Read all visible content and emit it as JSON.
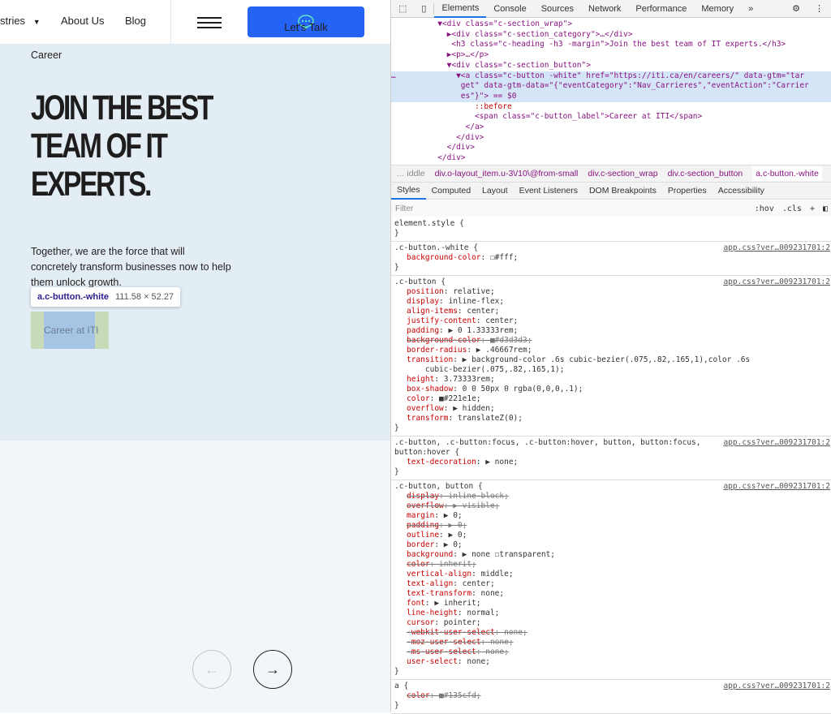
{
  "site": {
    "nav": {
      "industries": "stries",
      "about": "About Us",
      "blog": "Blog",
      "cta": "Let's Talk"
    },
    "category": "Career",
    "heading_lines": [
      "JOIN THE BEST",
      "TEAM OF IT",
      "EXPERTS."
    ],
    "paragraph": "Together, we are the force that will concretely transform businesses now to help them unlock growth.",
    "tooltip": {
      "selector": "a.c-button.-white",
      "size": "111.58 × 52.27"
    },
    "button": "Career at ITI",
    "colors": {
      "accent": "#2563f5",
      "hero_bg": "#e3edf4"
    }
  },
  "devtools": {
    "tabs": [
      "Elements",
      "Console",
      "Sources",
      "Network",
      "Performance",
      "Memory",
      "»"
    ],
    "dom": [
      "          ▼<div class=\"c-section_wrap\">",
      "            ▶<div class=\"c-section_category\">…</div>",
      "             <h3 class=\"c-heading -h3 -margin\">Join the best team of IT experts.</h3>",
      "            ▶<p>…</p>",
      "            ▼<div class=\"c-section_button\">",
      "…             ▼<a class=\"c-button -white\" href=\"https://iti.ca/en/careers/\" data-gtm=\"tar",
      "               get\" data-gtm-data=\"{\"eventCategory\":\"Nav_Carrieres\",\"eventAction\":\"Carrier",
      "               es\"}\"> == $0",
      "                  ::before",
      "                  <span class=\"c-button_label\">Career at ITI</span>",
      "                </a>",
      "              </div>",
      "            </div>",
      "          </div>"
    ],
    "breadcrumb": [
      "… iddle",
      "div.o-layout_item.u-3\\/10\\@from-small",
      "div.c-section_wrap",
      "div.c-section_button",
      "a.c-button.-white"
    ],
    "style_tabs": [
      "Styles",
      "Computed",
      "Layout",
      "Event Listeners",
      "DOM Breakpoints",
      "Properties",
      "Accessibility"
    ],
    "filter_placeholder": "Filter",
    "filter_tools": [
      ":hov",
      ".cls",
      "+"
    ],
    "rules": [
      {
        "selector": "element.style {",
        "source": "",
        "props": []
      },
      {
        "selector": ".c-button.-white {",
        "source": "app.css?ver…009231701:2",
        "props": [
          {
            "t": "background-color: ☐#fff;",
            "s": false
          }
        ]
      },
      {
        "selector": ".c-button {",
        "source": "app.css?ver…009231701:2",
        "props": [
          {
            "t": "position: relative;",
            "s": false
          },
          {
            "t": "display: inline-flex;",
            "s": false
          },
          {
            "t": "align-items: center;",
            "s": false
          },
          {
            "t": "justify-content: center;",
            "s": false
          },
          {
            "t": "padding: ▶ 0 1.33333rem;",
            "s": false
          },
          {
            "t": "background-color: ■#d3d3d3;",
            "s": true
          },
          {
            "t": "border-radius: ▶ .46667rem;",
            "s": false
          },
          {
            "t": "transition: ▶ background-color .6s cubic-bezier(.075,.82,.165,1),color .6s",
            "s": false
          },
          {
            "t": "    cubic-bezier(.075,.82,.165,1);",
            "s": false
          },
          {
            "t": "height: 3.73333rem;",
            "s": false
          },
          {
            "t": "box-shadow: 0 0 50px 0 rgba(0,0,0,.1);",
            "s": false
          },
          {
            "t": "color: ■#221e1e;",
            "s": false
          },
          {
            "t": "overflow: ▶ hidden;",
            "s": false
          },
          {
            "t": "transform: translateZ(0);",
            "s": false
          }
        ]
      },
      {
        "selector": ".c-button, .c-button:focus, .c-button:hover, button, button:focus,\nbutton:hover {",
        "source": "app.css?ver…009231701:2",
        "props": [
          {
            "t": "text-decoration: ▶ none;",
            "s": false
          }
        ]
      },
      {
        "selector": ".c-button, button {",
        "source": "app.css?ver…009231701:2",
        "props": [
          {
            "t": "display: inline-block;",
            "s": true
          },
          {
            "t": "overflow: ▶ visible;",
            "s": true
          },
          {
            "t": "margin: ▶ 0;",
            "s": false
          },
          {
            "t": "padding: ▶ 0;",
            "s": true
          },
          {
            "t": "outline: ▶ 0;",
            "s": false
          },
          {
            "t": "border: ▶ 0;",
            "s": false
          },
          {
            "t": "background: ▶ none ☐transparent;",
            "s": false
          },
          {
            "t": "color: inherit;",
            "s": true
          },
          {
            "t": "vertical-align: middle;",
            "s": false
          },
          {
            "t": "text-align: center;",
            "s": false
          },
          {
            "t": "text-transform: none;",
            "s": false
          },
          {
            "t": "font: ▶ inherit;",
            "s": false
          },
          {
            "t": "line-height: normal;",
            "s": false
          },
          {
            "t": "cursor: pointer;",
            "s": false
          },
          {
            "t": "-webkit-user-select: none;",
            "s": true
          },
          {
            "t": "-moz-user-select: none;",
            "s": true
          },
          {
            "t": "-ms-user-select: none;",
            "s": true
          },
          {
            "t": "user-select: none;",
            "s": false
          }
        ]
      },
      {
        "selector": "a {",
        "source": "app.css?ver…009231701:2",
        "props": [
          {
            "t": "color: ■#135cfd;",
            "s": true
          }
        ]
      }
    ]
  }
}
